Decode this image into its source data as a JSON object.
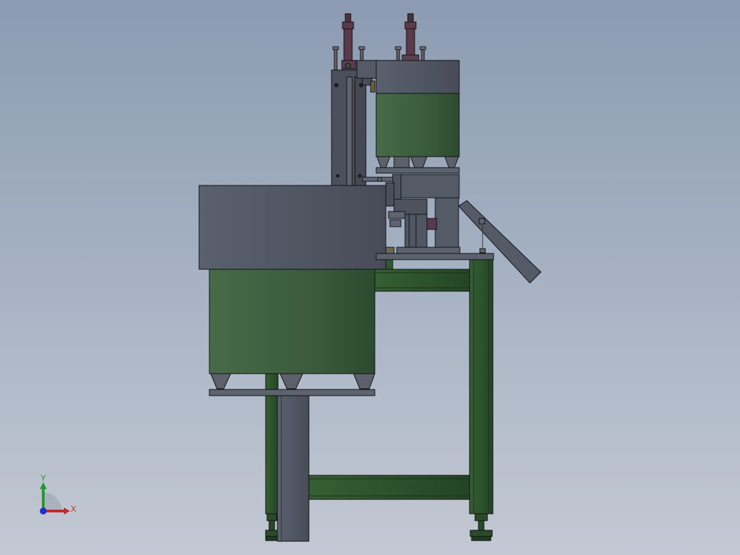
{
  "viewport": {
    "background_top": "#8c9bb1",
    "background_bottom": "#c3c9d3"
  },
  "colors": {
    "frame_green": "#2f5a2f",
    "frame_green_dark": "#1f3f1f",
    "hopper_green": "#3f6140",
    "steel_gray": "#4d535f",
    "steel_light": "#676e7b",
    "cylinder_maroon": "#5a3a4a",
    "axis_x": "#c0282b",
    "axis_y": "#1f9a2f",
    "axis_z": "#1e2ec8"
  },
  "triad": {
    "x_label": "X",
    "y_label": "Y"
  }
}
